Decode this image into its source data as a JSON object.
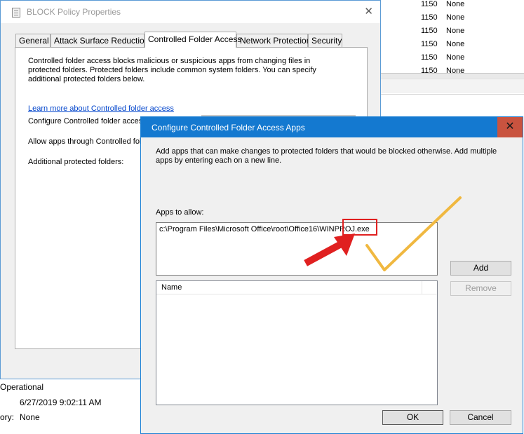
{
  "background": {
    "rows": [
      {
        "id": "1150",
        "level": "None"
      },
      {
        "id": "1150",
        "level": "None"
      },
      {
        "id": "1150",
        "level": "None"
      },
      {
        "id": "1150",
        "level": "None"
      },
      {
        "id": "1150",
        "level": "None"
      },
      {
        "id": "1150",
        "level": "None"
      }
    ],
    "details": {
      "status": "Operational",
      "datetime": "6/27/2019 9:02:11 AM",
      "category_label": "ory:",
      "category_value": "None"
    }
  },
  "properties_window": {
    "title": "BLOCK Policy Properties",
    "close_glyph": "✕",
    "tabs": [
      "General",
      "Attack Surface Reduction",
      "Controlled Folder Access",
      "Network Protection",
      "Security"
    ],
    "active_tab": "Controlled Folder Access",
    "description": "Controlled folder access blocks malicious or suspicious apps from changing files in protected folders. Protected folders include common system folders. You can specify additional protected folders below.",
    "learn_more_link": "Learn more about Controlled folder access",
    "configure_label": "Configure Controlled folder access",
    "allow_label": "Allow apps through Controlled fold",
    "additional_label": "Additional protected folders:"
  },
  "dialog": {
    "title": "Configure Controlled Folder Access Apps",
    "close_glyph": "✕",
    "description": "Add apps that can make changes to protected folders that would be blocked otherwise. Add multiple apps by entering each on a new line.",
    "apps_label": "Apps to allow:",
    "apps_value": "c:\\Program Files\\Microsoft Office\\root\\Office16\\WINPROJ.exe",
    "add_button": "Add",
    "remove_button": "Remove",
    "list_header": "Name",
    "ok_button": "OK",
    "cancel_button": "Cancel"
  },
  "annotation_colors": {
    "highlight_box": "#e02020",
    "arrow": "#e02020",
    "checkmark": "#f0b840"
  }
}
